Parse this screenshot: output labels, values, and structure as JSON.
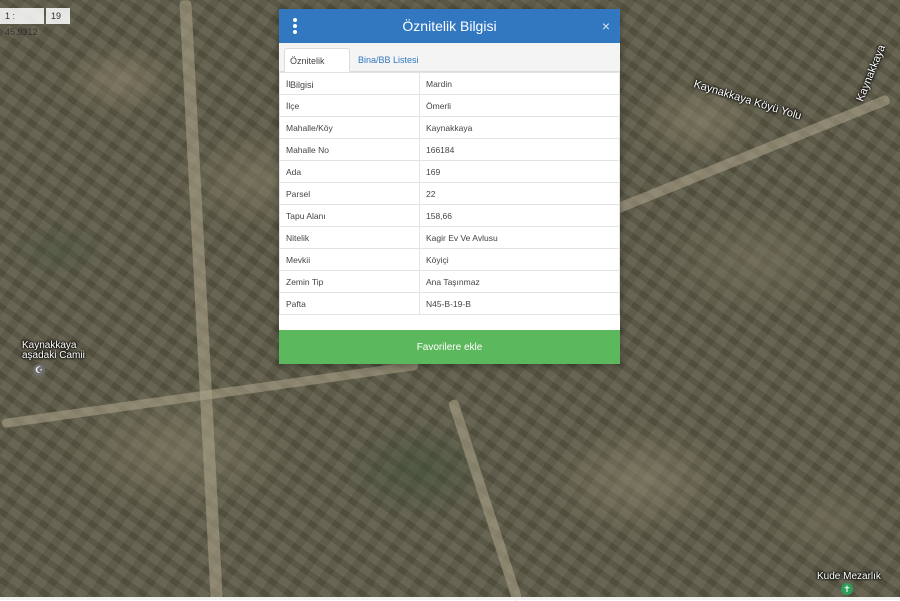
{
  "map": {
    "scale_left": "1 : 45.9312",
    "scale_zoom": "19",
    "labels": {
      "road_right": "Kaynakkaya Köyü Yolu",
      "road_diag": "Kaynakkaya",
      "mosque_line1": "Kaynakkaya",
      "mosque_line2": "aşadaki Camii",
      "cemetery": "Kude Mezarlık"
    },
    "icons": {
      "mosque": "mosque-icon",
      "cemetery": "cemetery-pin-icon"
    }
  },
  "dialog": {
    "title": "Öznitelik Bilgisi",
    "close_glyph": "×",
    "tabs": [
      {
        "label": "Öznitelik Bilgisi",
        "active": true
      },
      {
        "label": "Bina/BB Listesi",
        "active": false
      }
    ],
    "rows": [
      {
        "key": "İl",
        "value": "Mardin"
      },
      {
        "key": "İlçe",
        "value": "Ömerli"
      },
      {
        "key": "Mahalle/Köy",
        "value": "Kaynakkaya"
      },
      {
        "key": "Mahalle No",
        "value": "166184"
      },
      {
        "key": "Ada",
        "value": "169"
      },
      {
        "key": "Parsel",
        "value": "22"
      },
      {
        "key": "Tapu Alanı",
        "value": "158,66"
      },
      {
        "key": "Nitelik",
        "value": "Kagir Ev Ve Avlusu"
      },
      {
        "key": "Mevkii",
        "value": "Köyiçi"
      },
      {
        "key": "Zemin Tip",
        "value": "Ana Taşınmaz"
      },
      {
        "key": "Pafta",
        "value": "N45-B-19-B"
      }
    ],
    "favorite_button": "Favorilere ekle"
  },
  "colors": {
    "header_blue": "#3178c0",
    "button_green": "#5cb85c",
    "tab_link_blue": "#3178c0"
  }
}
